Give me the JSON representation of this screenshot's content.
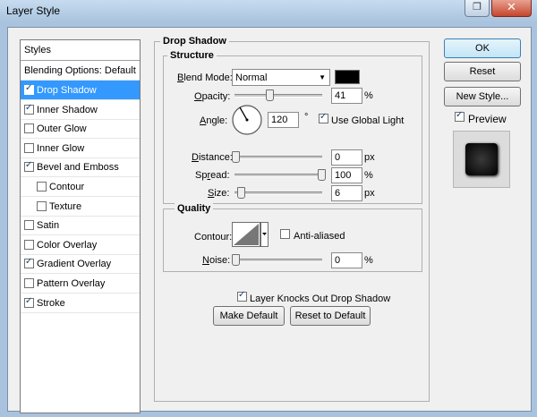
{
  "window": {
    "title": "Layer Style"
  },
  "styles_panel": {
    "header": "Styles",
    "blending_options": "Blending Options: Default",
    "items": [
      {
        "label": "Drop Shadow",
        "checked": true,
        "selected": true,
        "indent": false
      },
      {
        "label": "Inner Shadow",
        "checked": true,
        "selected": false,
        "indent": false
      },
      {
        "label": "Outer Glow",
        "checked": false,
        "selected": false,
        "indent": false
      },
      {
        "label": "Inner Glow",
        "checked": false,
        "selected": false,
        "indent": false
      },
      {
        "label": "Bevel and Emboss",
        "checked": true,
        "selected": false,
        "indent": false
      },
      {
        "label": "Contour",
        "checked": false,
        "selected": false,
        "indent": true
      },
      {
        "label": "Texture",
        "checked": false,
        "selected": false,
        "indent": true
      },
      {
        "label": "Satin",
        "checked": false,
        "selected": false,
        "indent": false
      },
      {
        "label": "Color Overlay",
        "checked": false,
        "selected": false,
        "indent": false
      },
      {
        "label": "Gradient Overlay",
        "checked": true,
        "selected": false,
        "indent": false
      },
      {
        "label": "Pattern Overlay",
        "checked": false,
        "selected": false,
        "indent": false
      },
      {
        "label": "Stroke",
        "checked": true,
        "selected": false,
        "indent": false
      }
    ]
  },
  "drop_shadow": {
    "title": "Drop Shadow",
    "structure": {
      "title": "Structure",
      "blend_mode_label": "Blend Mode:",
      "blend_mode_value": "Normal",
      "color": "#000000",
      "opacity_label": "Opacity:",
      "opacity_value": "41",
      "opacity_unit": "%",
      "angle_label": "Angle:",
      "angle_value": "120",
      "angle_unit": "°",
      "use_global_light_label": "Use Global Light",
      "use_global_light": true,
      "distance_label": "Distance:",
      "distance_value": "0",
      "distance_unit": "px",
      "spread_label": "Spread:",
      "spread_value": "100",
      "spread_unit": "%",
      "size_label": "Size:",
      "size_value": "6",
      "size_unit": "px"
    },
    "quality": {
      "title": "Quality",
      "contour_label": "Contour:",
      "anti_aliased_label": "Anti-aliased",
      "anti_aliased": false,
      "noise_label": "Noise:",
      "noise_value": "0",
      "noise_unit": "%"
    },
    "knockout_label": "Layer Knocks Out Drop Shadow",
    "knockout": true,
    "make_default_label": "Make Default",
    "reset_default_label": "Reset to Default"
  },
  "buttons": {
    "ok": "OK",
    "reset": "Reset",
    "new_style": "New Style...",
    "preview_label": "Preview",
    "preview_checked": true
  }
}
